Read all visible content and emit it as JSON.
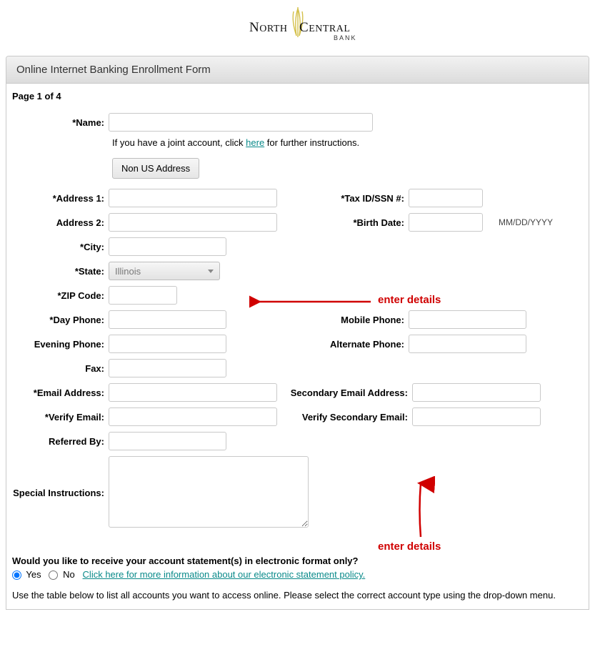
{
  "logo": {
    "line1": "NORTH",
    "line2": "CENTRAL",
    "sub": "BANK"
  },
  "panel_title": "Online Internet Banking Enrollment Form",
  "page_indicator": "Page 1 of 4",
  "labels": {
    "name": "*Name:",
    "joint_pre": "If you have a joint account, click ",
    "joint_link": "here",
    "joint_post": " for further instructions.",
    "non_us": "Non US Address",
    "address1": "*Address 1:",
    "address2": "Address 2:",
    "city": "*City:",
    "state": "*State:",
    "zip": "*ZIP Code:",
    "tax": "*Tax ID/SSN #:",
    "birth": "*Birth Date:",
    "birth_hint": "MM/DD/YYYY",
    "day_phone": "*Day Phone:",
    "evening_phone": "Evening Phone:",
    "fax": "Fax:",
    "mobile": "Mobile Phone:",
    "alternate": "Alternate Phone:",
    "email": "*Email Address:",
    "verify_email": "*Verify Email:",
    "secondary_email": "Secondary Email Address:",
    "verify_secondary": "Verify Secondary Email:",
    "referred": "Referred By:",
    "special": "Special Instructions:"
  },
  "values": {
    "name": "",
    "address1": "",
    "address2": "",
    "city": "",
    "state": "Illinois",
    "zip": "",
    "tax": "",
    "birth": "",
    "day_phone": "",
    "evening_phone": "",
    "fax": "",
    "mobile": "",
    "alternate": "",
    "email": "",
    "verify_email": "",
    "secondary_email": "",
    "verify_secondary": "",
    "referred": "",
    "special": ""
  },
  "question": "Would you like to receive your account statement(s) in electronic format only?",
  "radio": {
    "yes": "Yes",
    "no": "No",
    "selected": "yes"
  },
  "policy_link": "Click here for more information about our electronic statement policy.",
  "table_instr": "Use the table below to list all accounts you want to access online. Please select the correct account type using the drop-down menu.",
  "annotation": {
    "text1": "enter details",
    "text2": "enter details"
  }
}
